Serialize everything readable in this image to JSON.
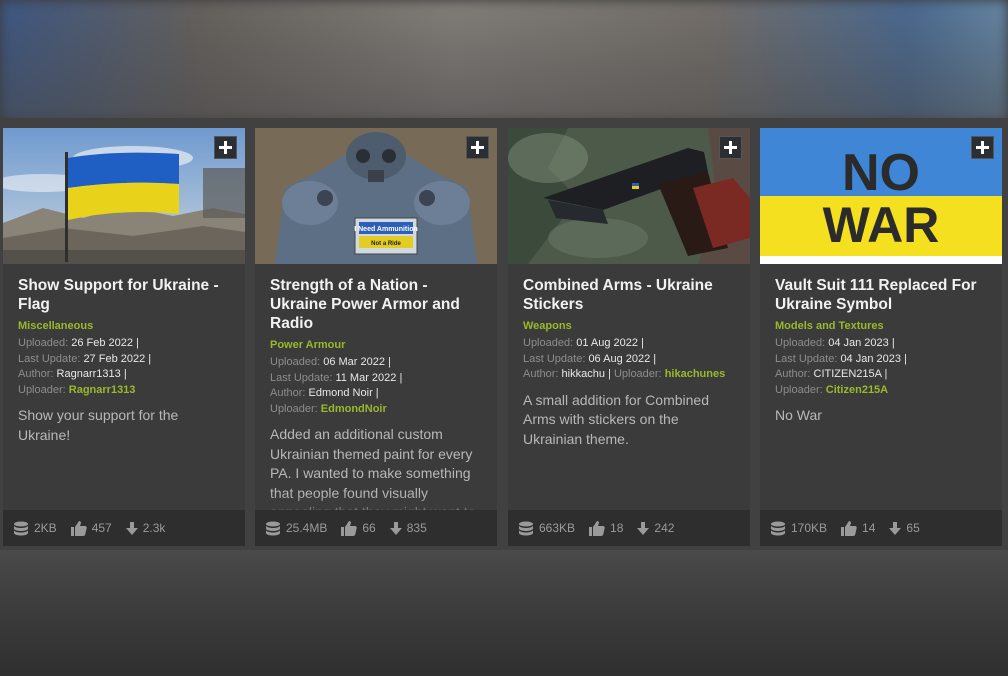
{
  "cards": [
    {
      "title": "Show Support for Ukraine - Flag",
      "category": "Miscellaneous",
      "uploaded_label": "Uploaded:",
      "uploaded": "26 Feb 2022",
      "updated_label": "Last Update:",
      "updated": "27 Feb 2022",
      "author_label": "Author:",
      "author": "Ragnarr1313",
      "uploader_label": "Uploader:",
      "uploader": "Ragnarr1313",
      "description": "Show your support for the Ukraine!",
      "size": "2KB",
      "endorsements": "457",
      "downloads": "2.3k"
    },
    {
      "title": "Strength of a Nation - Ukraine Power Armor and Radio",
      "category": "Power Armour",
      "uploaded_label": "Uploaded:",
      "uploaded": "06 Mar 2022",
      "updated_label": "Last Update:",
      "updated": "11 Mar 2022",
      "author_label": "Author:",
      "author": "Edmond Noir",
      "uploader_label": "Uploader:",
      "uploader": "EdmondNoir",
      "description": "Added an additional custom Ukrainian themed paint for every PA. I wanted to make something that people found visually appealing that they might want to keep in their game for a long tim",
      "sign_line1": "I Need Ammunition",
      "sign_line2": "Not a Ride",
      "size": "25.4MB",
      "endorsements": "66",
      "downloads": "835"
    },
    {
      "title": "Combined Arms - Ukraine Stickers",
      "category": "Weapons",
      "uploaded_label": "Uploaded:",
      "uploaded": "01 Aug 2022",
      "updated_label": "Last Update:",
      "updated": "06 Aug 2022",
      "author_label": "Author:",
      "author": "hikkachu",
      "uploader_label": "Uploader:",
      "uploader": "hikachunes",
      "description": "A small addition for Combined Arms with stickers on the Ukrainian theme.",
      "size": "663KB",
      "endorsements": "18",
      "downloads": "242"
    },
    {
      "title": "Vault Suit 111 Replaced For Ukraine Symbol",
      "category": "Models and Textures",
      "uploaded_label": "Uploaded:",
      "uploaded": "04 Jan 2023",
      "updated_label": "Last Update:",
      "updated": "04 Jan 2023",
      "author_label": "Author:",
      "author": "CITIZEN215A",
      "uploader_label": "Uploader:",
      "uploader": "Citizen215A",
      "description": "No War",
      "thumb_line1": "NO",
      "thumb_line2": "WAR",
      "size": "170KB",
      "endorsements": "14",
      "downloads": "65"
    }
  ],
  "colors": {
    "accent": "#9ab82b",
    "card_bg": "#3b3b3b",
    "footer_bg": "#2e2e2e",
    "ukraine_blue": "#1f5fc4",
    "ukraine_yellow": "#f2dc19"
  }
}
